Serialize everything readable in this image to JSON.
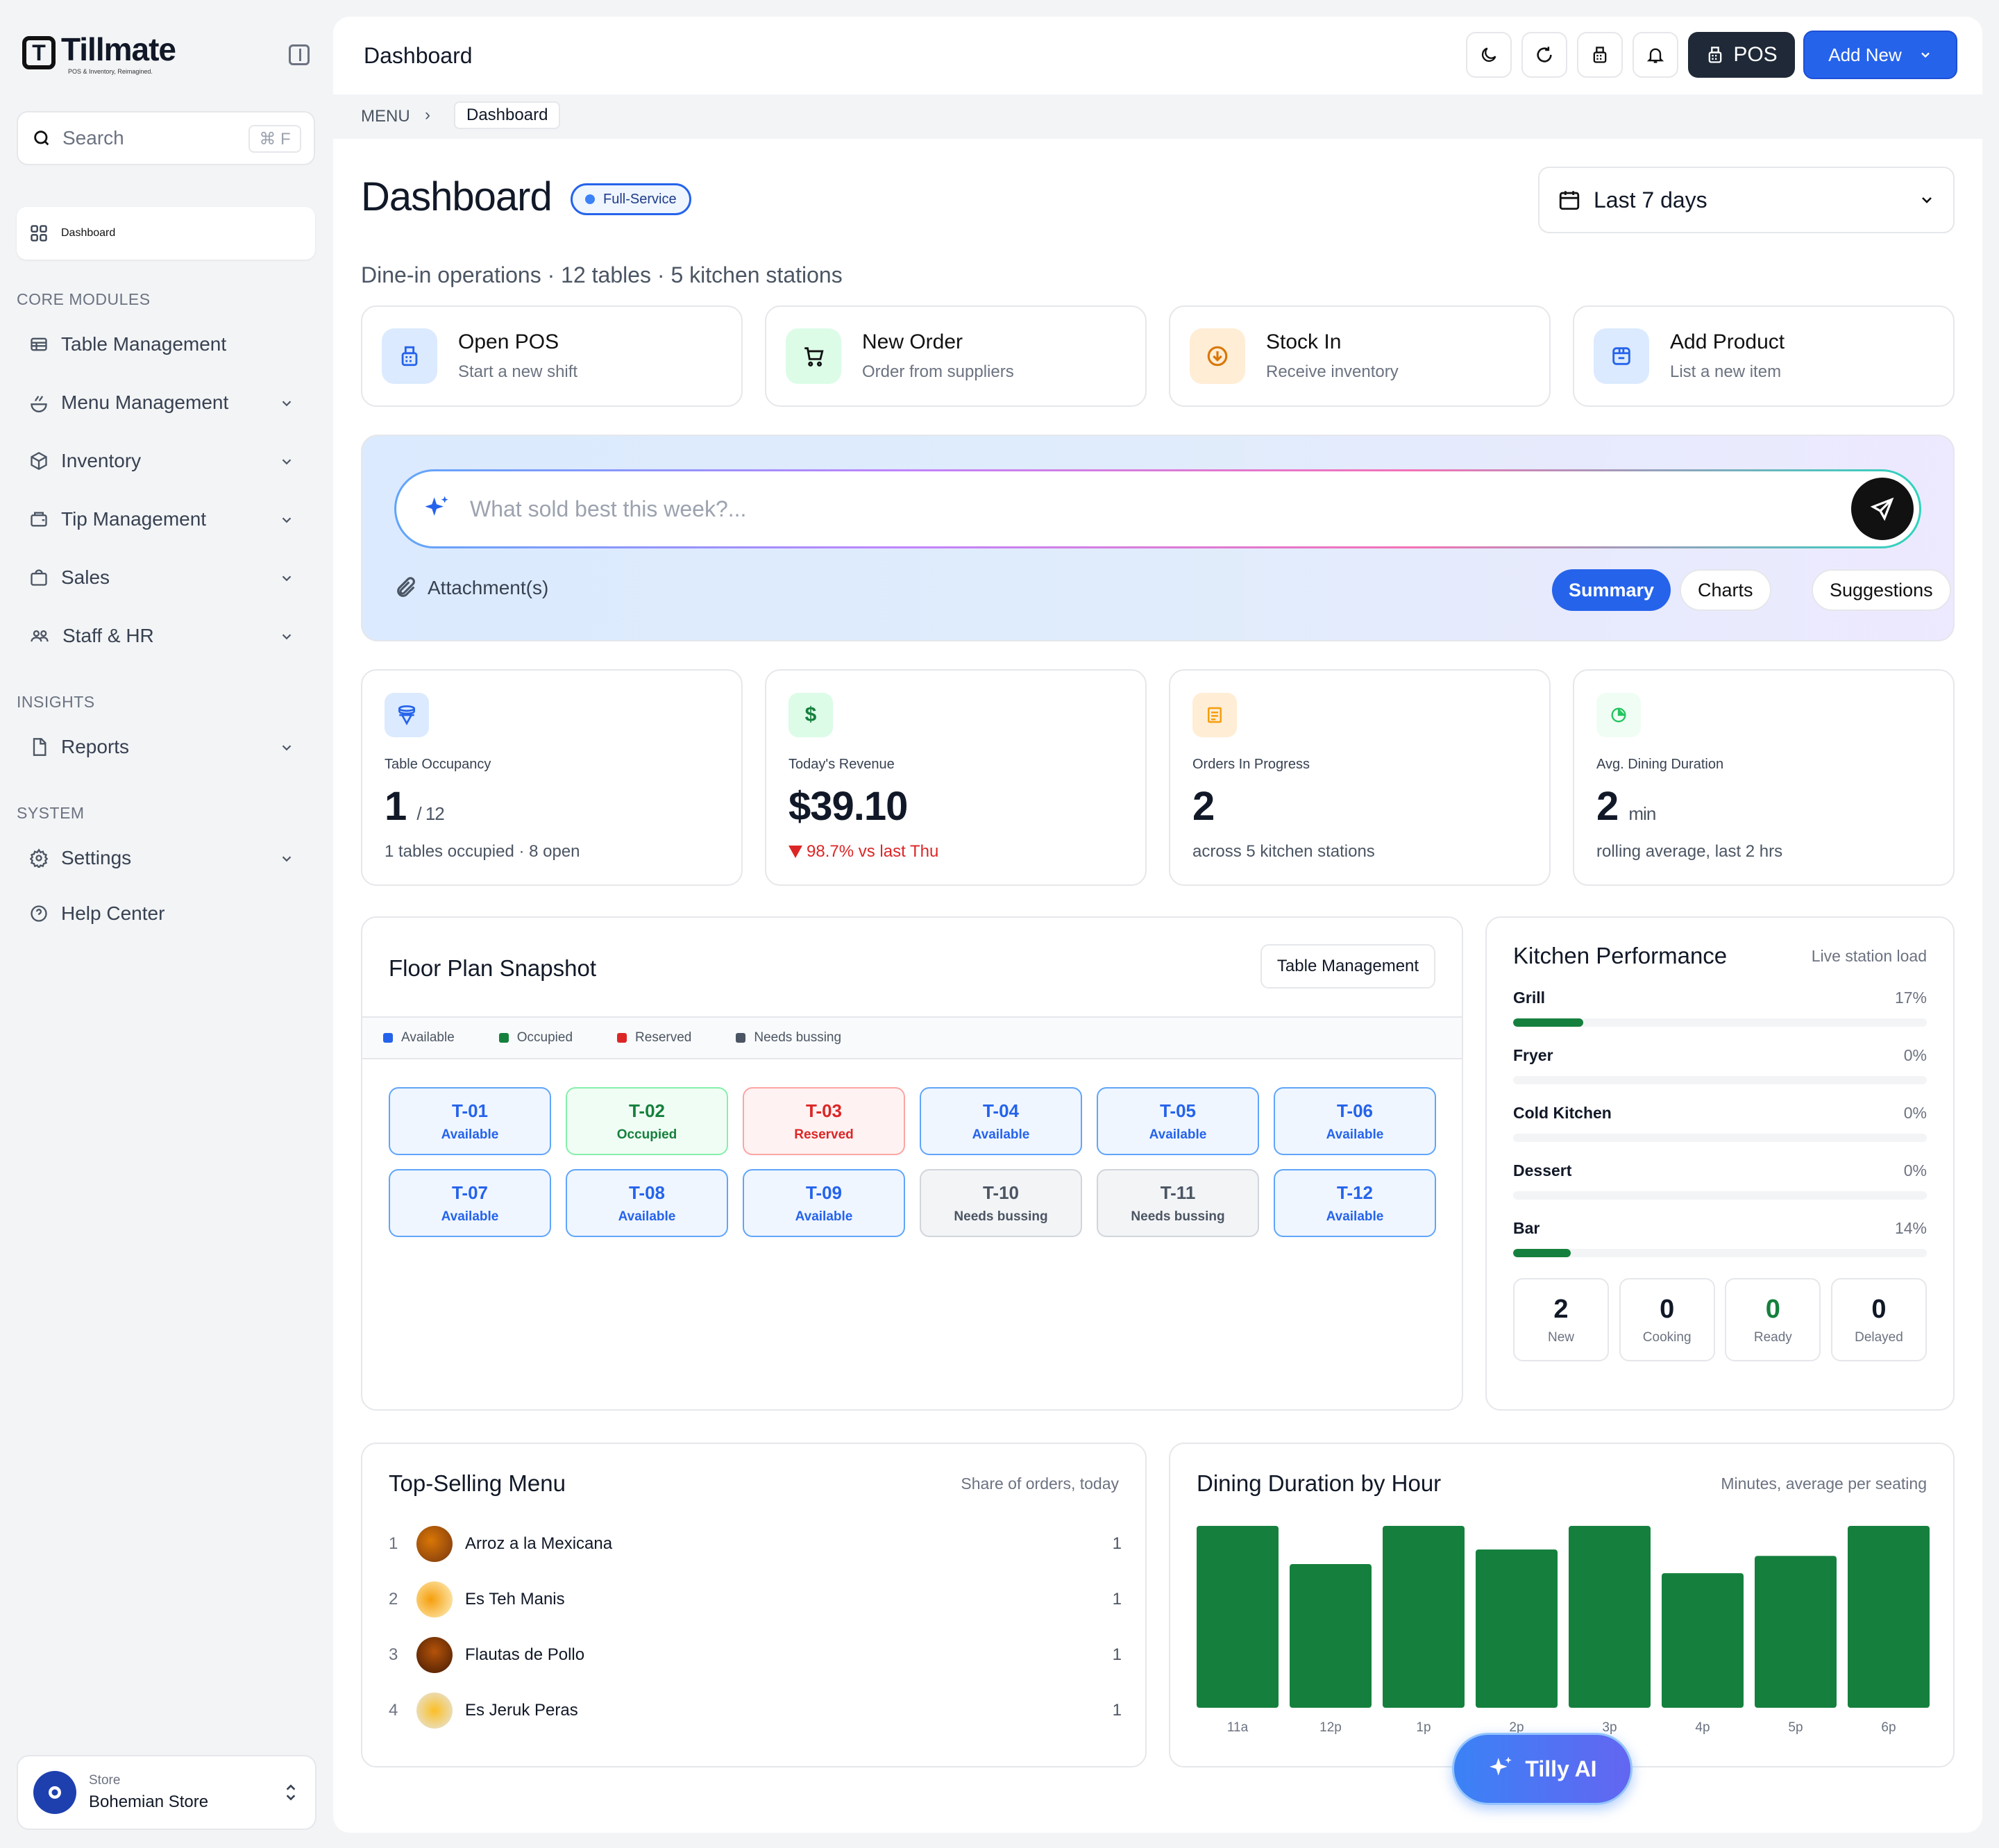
{
  "brand": {
    "name": "Tillmate",
    "tagline": "POS & Inventory, Reimagined."
  },
  "sidebar": {
    "search_placeholder": "Search",
    "search_shortcut": "⌘ F",
    "active_item": "Dashboard",
    "sections": [
      {
        "label": "CORE MODULES",
        "items": [
          "Table Management",
          "Menu Management",
          "Inventory",
          "Tip Management",
          "Sales",
          "Staff & HR"
        ]
      },
      {
        "label": "INSIGHTS",
        "items": [
          "Reports"
        ]
      },
      {
        "label": "SYSTEM",
        "items": [
          "Settings",
          "Help Center"
        ]
      }
    ],
    "store_label": "Store",
    "store_name": "Bohemian Store"
  },
  "topbar": {
    "title": "Dashboard",
    "pos_label": "POS",
    "add_new_label": "Add New"
  },
  "breadcrumb": {
    "root": "MENU",
    "sep": "›",
    "current": "Dashboard"
  },
  "page": {
    "title": "Dashboard",
    "badge": "Full-Service",
    "subtitle": "Dine-in operations · 12 tables · 5 kitchen stations",
    "date_range": "Last 7 days"
  },
  "quick_actions": [
    {
      "title": "Open POS",
      "sub": "Start a new shift"
    },
    {
      "title": "New Order",
      "sub": "Order from suppliers"
    },
    {
      "title": "Stock In",
      "sub": "Receive inventory"
    },
    {
      "title": "Add Product",
      "sub": "List a new item"
    }
  ],
  "ai": {
    "placeholder": "What sold best this week?...",
    "attach_label": "Attachment(s)",
    "pills": [
      "Summary",
      "Charts",
      "Suggestions"
    ],
    "active_pill": "Summary"
  },
  "stats": [
    {
      "label": "Table Occupancy",
      "value": "1",
      "unit": "/ 12",
      "foot": "1 tables occupied · 8 open"
    },
    {
      "label": "Today's Revenue",
      "value": "$39.10",
      "unit": "",
      "foot": "98.7% vs last Thu"
    },
    {
      "label": "Orders In Progress",
      "value": "2",
      "unit": "",
      "foot": "across 5 kitchen stations"
    },
    {
      "label": "Avg. Dining Duration",
      "value": "2",
      "unit": "min",
      "foot": "rolling average, last 2 hrs"
    }
  ],
  "floor": {
    "title": "Floor Plan Snapshot",
    "button": "Table Management",
    "legend": [
      "Available",
      "Occupied",
      "Reserved",
      "Needs bussing"
    ],
    "tables": [
      {
        "id": "T-01",
        "status": "Available"
      },
      {
        "id": "T-02",
        "status": "Occupied"
      },
      {
        "id": "T-03",
        "status": "Reserved"
      },
      {
        "id": "T-04",
        "status": "Available"
      },
      {
        "id": "T-05",
        "status": "Available"
      },
      {
        "id": "T-06",
        "status": "Available"
      },
      {
        "id": "T-07",
        "status": "Available"
      },
      {
        "id": "T-08",
        "status": "Available"
      },
      {
        "id": "T-09",
        "status": "Available"
      },
      {
        "id": "T-10",
        "status": "Needs bussing"
      },
      {
        "id": "T-11",
        "status": "Needs bussing"
      },
      {
        "id": "T-12",
        "status": "Available"
      }
    ]
  },
  "kitchen": {
    "title": "Kitchen Performance",
    "subtitle": "Live station load",
    "stations": [
      {
        "name": "Grill",
        "pct_label": "17%",
        "load": 0.17
      },
      {
        "name": "Fryer",
        "pct_label": "0%",
        "load": 0
      },
      {
        "name": "Cold Kitchen",
        "pct_label": "0%",
        "load": 0
      },
      {
        "name": "Dessert",
        "pct_label": "0%",
        "load": 0
      },
      {
        "name": "Bar",
        "pct_label": "14%",
        "load": 0.14
      }
    ],
    "counts": [
      {
        "value": "2",
        "label": "New"
      },
      {
        "value": "0",
        "label": "Cooking"
      },
      {
        "value": "0",
        "label": "Ready"
      },
      {
        "value": "0",
        "label": "Delayed"
      }
    ]
  },
  "top_menu": {
    "title": "Top-Selling Menu",
    "subtitle": "Share of orders, today",
    "items": [
      {
        "rank": "1",
        "name": "Arroz a la Mexicana",
        "count": "1"
      },
      {
        "rank": "2",
        "name": "Es Teh Manis",
        "count": "1"
      },
      {
        "rank": "3",
        "name": "Flautas de Pollo",
        "count": "1"
      },
      {
        "rank": "4",
        "name": "Es Jeruk Peras",
        "count": "1"
      }
    ]
  },
  "chart_data": {
    "type": "bar",
    "title": "Dining Duration by Hour",
    "subtitle": "Minutes, average per seating",
    "categories": [
      "11a",
      "12p",
      "1p",
      "2p",
      "3p",
      "4p",
      "5p",
      "6p"
    ],
    "values": [
      2.0,
      1.58,
      2.0,
      1.74,
      2.0,
      1.48,
      1.67,
      2.0
    ],
    "ylim": [
      0,
      2
    ],
    "color": "#15803d"
  },
  "assistant": {
    "label": "Tilly AI"
  },
  "colors": {
    "accent": "#2563eb",
    "success": "#15803d",
    "danger": "#dc2626",
    "muted": "#6b7280"
  }
}
